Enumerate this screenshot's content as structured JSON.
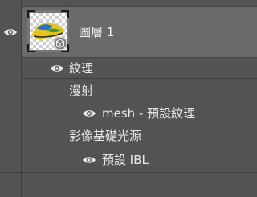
{
  "layers_panel": {
    "layer": {
      "name": "圖層 1",
      "thumbnail_icon": "3d-model-thumbnail-icon",
      "visibility_icon": "eye-icon"
    },
    "textures_group": {
      "label": "紋理",
      "visibility_icon": "eye-icon"
    },
    "diffuse": {
      "label": "漫射"
    },
    "diffuse_texture": {
      "label": "mesh - 預設紋理",
      "visibility_icon": "eye-icon"
    },
    "ibl": {
      "label": "影像基礎光源"
    },
    "ibl_preset": {
      "label": "預設 IBL",
      "visibility_icon": "eye-icon"
    }
  },
  "colors": {
    "panel_bg": "#535353",
    "selected_layer_bg": "#6a6a6a",
    "text": "#e8e8e8",
    "divider": "#3f3f3f"
  }
}
